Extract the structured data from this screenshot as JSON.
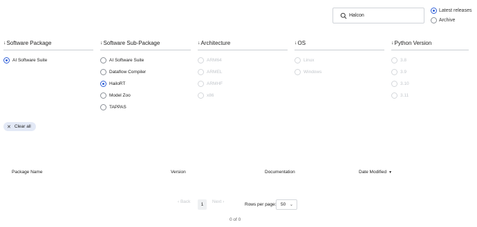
{
  "search": {
    "value": "Halcon",
    "icon": "search-icon"
  },
  "releases": [
    {
      "label": "Latest releases",
      "selected": true
    },
    {
      "label": "Archive",
      "selected": false
    }
  ],
  "columns": [
    {
      "header": "Software Package",
      "options": [
        {
          "label": "AI Software Suite",
          "selected": true,
          "disabled": false
        }
      ]
    },
    {
      "header": "Software Sub-Package",
      "options": [
        {
          "label": "AI Software Suite",
          "selected": false,
          "disabled": false
        },
        {
          "label": "Dataflow Compiler",
          "selected": false,
          "disabled": false
        },
        {
          "label": "HailoRT",
          "selected": true,
          "disabled": false
        },
        {
          "label": "Model Zoo",
          "selected": false,
          "disabled": false
        },
        {
          "label": "TAPPAS",
          "selected": false,
          "disabled": false
        }
      ]
    },
    {
      "header": "Architecture",
      "options": [
        {
          "label": "ARM64",
          "selected": false,
          "disabled": true
        },
        {
          "label": "ARMEL",
          "selected": false,
          "disabled": true
        },
        {
          "label": "ARMHF",
          "selected": false,
          "disabled": true
        },
        {
          "label": "x86",
          "selected": false,
          "disabled": true
        }
      ]
    },
    {
      "header": "OS",
      "options": [
        {
          "label": "Linux",
          "selected": false,
          "disabled": true
        },
        {
          "label": "Windows",
          "selected": false,
          "disabled": true
        }
      ]
    },
    {
      "header": "Python Version",
      "options": [
        {
          "label": "3.8",
          "selected": false,
          "disabled": true
        },
        {
          "label": "3.9",
          "selected": false,
          "disabled": true
        },
        {
          "label": "3.10",
          "selected": false,
          "disabled": true
        },
        {
          "label": "3.11",
          "selected": false,
          "disabled": true
        }
      ]
    }
  ],
  "sort_arrow": "↓",
  "clear_all": "Clear all",
  "table": {
    "headers": [
      "Package Name",
      "Version",
      "Documentation",
      "Date Modified"
    ],
    "sort_caret": "▼"
  },
  "pagination": {
    "back": "‹ Back",
    "page": "1",
    "next": "Next ›",
    "rows_label": "Rows per page:",
    "rows_value": "50",
    "count": "0 of 0"
  },
  "colors": {
    "accent": "#2f5fd7",
    "chip_bg": "#e3e9f6",
    "disabled_text": "#c2c6cb"
  }
}
